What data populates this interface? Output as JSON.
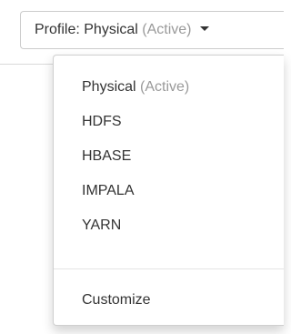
{
  "profile_toggle": {
    "prefix": "Profile: Physical",
    "status": "(Active)",
    "icon": "caret-down-icon"
  },
  "menu": {
    "items": [
      {
        "label": "Physical",
        "status": "(Active)"
      },
      {
        "label": "HDFS"
      },
      {
        "label": "HBASE"
      },
      {
        "label": "IMPALA"
      },
      {
        "label": "YARN"
      }
    ],
    "customize_label": "Customize"
  }
}
